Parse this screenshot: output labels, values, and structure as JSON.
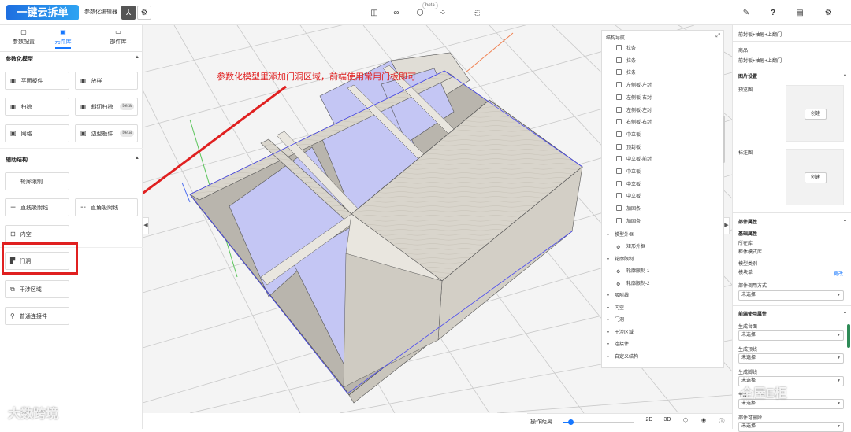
{
  "app": {
    "logo_text": "一键云拆单",
    "editor_name": "参数化编辑器",
    "beta_label": "beta"
  },
  "left_panel": {
    "tabs": [
      {
        "label": "参数配置",
        "icon": "document-icon",
        "active": false
      },
      {
        "label": "元件库",
        "icon": "component-icon",
        "active": true
      },
      {
        "label": "部件库",
        "icon": "folder-icon",
        "active": false
      }
    ],
    "sections": [
      {
        "title": "参数化模型",
        "buttons": [
          {
            "label": "平面板件",
            "badge": ""
          },
          {
            "label": "放样",
            "badge": ""
          },
          {
            "label": "扫掠",
            "badge": ""
          },
          {
            "label": "斜切扫掠",
            "badge": "beta"
          },
          {
            "label": "网格",
            "badge": ""
          },
          {
            "label": "边型板件",
            "badge": "beta"
          }
        ]
      },
      {
        "title": "辅助结构",
        "buttons": [
          {
            "label": "轮廓限制"
          },
          {
            "label": "直线吸附线"
          },
          {
            "label": "直角吸附线"
          },
          {
            "label": "内空"
          },
          {
            "label": "门洞"
          },
          {
            "label": "干涉区域"
          },
          {
            "label": "普通连接件"
          }
        ]
      }
    ]
  },
  "annotation": {
    "text": "参数化模型里添加门洞区域，前端使用常用门板即可",
    "color": "#e02020"
  },
  "structure_nav": {
    "title": "结构导航",
    "items": [
      "拉条",
      "拉条",
      "拉条",
      "左侧板-左封",
      "左侧板-右封",
      "左侧板-左封",
      "右侧板-右封",
      "中立板",
      "顶封板",
      "中立板-前封",
      "中立板",
      "中立板",
      "中立板",
      "加固条",
      "加固条"
    ],
    "groups": [
      {
        "label": "模型外框",
        "children": [
          "矩形外框"
        ]
      },
      {
        "label": "轮廓限制",
        "children": [
          "轮廓限制-1",
          "轮廓限制-2"
        ]
      },
      {
        "label": "吸附线",
        "children": []
      },
      {
        "label": "内空",
        "children": []
      },
      {
        "label": "门洞",
        "children": []
      },
      {
        "label": "干涉区域",
        "children": []
      },
      {
        "label": "连接件",
        "children": []
      },
      {
        "label": "自定义结构",
        "children": []
      }
    ]
  },
  "bottom_bar": {
    "label": "操作距离",
    "slider_fraction": 0.1,
    "btn_2d": "2D",
    "btn_3d": "3D"
  },
  "right_panel": {
    "breadcrumb": "前封板+抽屉+上翻门",
    "product_label": "商品",
    "product_value": "前封板+抽屉+上翻门",
    "image_settings_title": "图片设置",
    "preview_label": "预览图",
    "annotation_label": "标注图",
    "create_label": "创建",
    "component_props_title": "部件属性",
    "basic_props_title": "基础属性",
    "library_label": "所在库",
    "library_value": "柜体模式库",
    "model_type_label": "模型类别",
    "model_type_value": "模块单",
    "change_link": "更改",
    "call_mode_label": "部件调用方式",
    "select_placeholder": "未选择",
    "frontend_props_title": "前端使用属性",
    "gen_countertop_label": "生成台面",
    "gen_topline_label": "生成顶线",
    "gen_footline_label": "生成脚线",
    "gen_other_label": "生成",
    "deletable_label": "部件可删除"
  },
  "watermarks": [
    "大数跨境",
    "全屋E柜"
  ],
  "colors": {
    "accent": "#1677ff",
    "highlight": "#e02020",
    "door_opening": "#c4c6f4",
    "board": "#dcd8cf"
  }
}
